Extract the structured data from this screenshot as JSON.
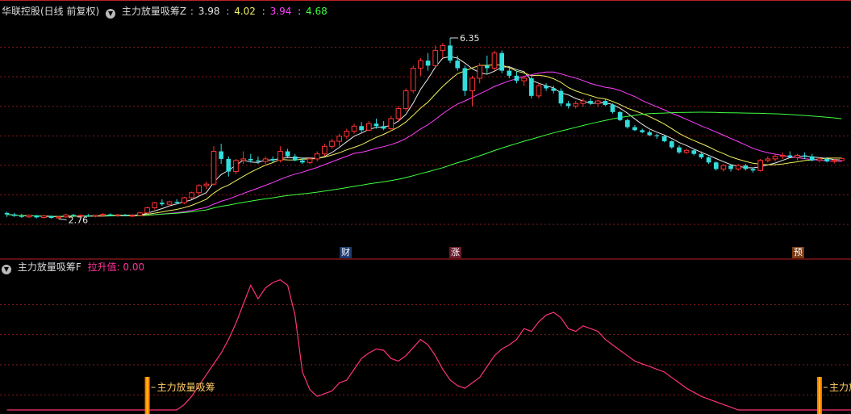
{
  "top_panel": {
    "stock_title": "华联控股(日线 前复权)",
    "indicator_name": "主力放量吸筹Z",
    "value_sep": ":",
    "values": [
      {
        "text": "3.98",
        "color": "#e8e8e8"
      },
      {
        "text": "4.02",
        "color": "#f0f060"
      },
      {
        "text": "3.94",
        "color": "#ff40ff"
      },
      {
        "text": "4.68",
        "color": "#40ff40"
      }
    ],
    "markers": {
      "cai": "财",
      "zhang": "涨",
      "yu": "预"
    }
  },
  "bottom_panel": {
    "indicator_name": "主力放量吸筹F",
    "value_label": "拉升值: 0.00",
    "signal_label": "主力放量吸筹"
  },
  "chart_data": [
    {
      "type": "candlestick",
      "title": "华联控股(日线 前复权)",
      "price_range": [
        2.3,
        6.75
      ],
      "grid": "dotted red horizontal",
      "annotations": [
        {
          "label": "6.35",
          "type": "high",
          "at_index": 60
        },
        {
          "label": "2.76",
          "type": "low",
          "at_index": 7
        }
      ],
      "candles": [
        [
          2.88,
          2.9,
          2.8,
          2.85
        ],
        [
          2.85,
          2.88,
          2.8,
          2.82
        ],
        [
          2.82,
          2.86,
          2.78,
          2.8
        ],
        [
          2.8,
          2.85,
          2.78,
          2.83
        ],
        [
          2.83,
          2.84,
          2.77,
          2.79
        ],
        [
          2.79,
          2.84,
          2.77,
          2.82
        ],
        [
          2.82,
          2.83,
          2.77,
          2.78
        ],
        [
          2.78,
          2.82,
          2.76,
          2.8
        ],
        [
          2.8,
          2.86,
          2.78,
          2.84
        ],
        [
          2.84,
          2.86,
          2.8,
          2.82
        ],
        [
          2.82,
          2.85,
          2.8,
          2.83
        ],
        [
          2.83,
          2.86,
          2.8,
          2.81
        ],
        [
          2.81,
          2.84,
          2.79,
          2.83
        ],
        [
          2.83,
          2.88,
          2.8,
          2.85
        ],
        [
          2.85,
          2.87,
          2.81,
          2.83
        ],
        [
          2.83,
          2.86,
          2.8,
          2.84
        ],
        [
          2.84,
          2.86,
          2.81,
          2.82
        ],
        [
          2.82,
          2.85,
          2.8,
          2.83
        ],
        [
          2.83,
          2.9,
          2.82,
          2.88
        ],
        [
          2.88,
          3.0,
          2.86,
          2.98
        ],
        [
          2.98,
          3.1,
          2.95,
          3.08
        ],
        [
          3.08,
          3.15,
          3.02,
          3.05
        ],
        [
          3.05,
          3.12,
          3.0,
          3.1
        ],
        [
          3.1,
          3.15,
          3.05,
          3.08
        ],
        [
          3.08,
          3.2,
          3.05,
          3.18
        ],
        [
          3.18,
          3.3,
          3.15,
          3.28
        ],
        [
          3.28,
          3.45,
          3.25,
          3.42
        ],
        [
          3.42,
          3.5,
          3.35,
          3.45
        ],
        [
          3.45,
          4.2,
          3.42,
          4.1
        ],
        [
          4.1,
          4.25,
          3.85,
          3.95
        ],
        [
          3.95,
          4.0,
          3.6,
          3.7
        ],
        [
          3.7,
          3.95,
          3.65,
          3.92
        ],
        [
          3.92,
          4.1,
          3.85,
          3.95
        ],
        [
          3.95,
          4.05,
          3.88,
          3.92
        ],
        [
          3.92,
          4.0,
          3.85,
          3.9
        ],
        [
          3.9,
          4.0,
          3.85,
          3.95
        ],
        [
          3.95,
          4.0,
          3.88,
          3.92
        ],
        [
          3.92,
          4.2,
          3.88,
          4.1
        ],
        [
          4.1,
          4.15,
          3.98,
          4.0
        ],
        [
          4.0,
          4.05,
          3.9,
          3.92
        ],
        [
          3.92,
          3.98,
          3.85,
          3.88
        ],
        [
          3.88,
          3.98,
          3.85,
          3.95
        ],
        [
          3.95,
          4.1,
          3.9,
          4.05
        ],
        [
          4.05,
          4.25,
          4.0,
          4.2
        ],
        [
          4.2,
          4.35,
          4.15,
          4.3
        ],
        [
          4.3,
          4.45,
          4.2,
          4.4
        ],
        [
          4.4,
          4.55,
          4.35,
          4.5
        ],
        [
          4.5,
          4.65,
          4.45,
          4.6
        ],
        [
          4.6,
          4.68,
          4.48,
          4.52
        ],
        [
          4.52,
          4.7,
          4.5,
          4.65
        ],
        [
          4.65,
          4.75,
          4.55,
          4.6
        ],
        [
          4.6,
          4.7,
          4.52,
          4.55
        ],
        [
          4.55,
          4.8,
          4.5,
          4.75
        ],
        [
          4.75,
          5.0,
          4.7,
          4.95
        ],
        [
          4.95,
          5.35,
          4.9,
          5.3
        ],
        [
          5.3,
          5.8,
          5.25,
          5.75
        ],
        [
          5.75,
          5.95,
          5.6,
          5.9
        ],
        [
          5.9,
          6.05,
          5.7,
          5.8
        ],
        [
          5.8,
          6.2,
          5.75,
          6.1
        ],
        [
          6.1,
          6.25,
          5.95,
          6.2
        ],
        [
          6.2,
          6.35,
          5.85,
          5.9
        ],
        [
          5.9,
          6.0,
          5.7,
          5.75
        ],
        [
          5.75,
          5.8,
          5.2,
          5.3
        ],
        [
          5.3,
          5.6,
          5.0,
          5.55
        ],
        [
          5.55,
          5.85,
          5.45,
          5.8
        ],
        [
          5.8,
          6.0,
          5.65,
          5.75
        ],
        [
          5.75,
          6.1,
          5.7,
          6.05
        ],
        [
          6.05,
          6.1,
          5.65,
          5.7
        ],
        [
          5.7,
          5.75,
          5.55,
          5.6
        ],
        [
          5.6,
          5.7,
          5.45,
          5.5
        ],
        [
          5.5,
          5.6,
          5.4,
          5.55
        ],
        [
          5.55,
          5.6,
          5.15,
          5.2
        ],
        [
          5.2,
          5.45,
          5.15,
          5.4
        ],
        [
          5.4,
          5.45,
          5.3,
          5.35
        ],
        [
          5.35,
          5.4,
          5.25,
          5.3
        ],
        [
          5.3,
          5.35,
          5.0,
          5.05
        ],
        [
          5.05,
          5.1,
          4.95,
          5.0
        ],
        [
          5.0,
          5.1,
          4.95,
          5.05
        ],
        [
          5.05,
          5.15,
          4.98,
          5.1
        ],
        [
          5.1,
          5.15,
          5.02,
          5.05
        ],
        [
          5.05,
          5.12,
          4.98,
          5.1
        ],
        [
          5.1,
          5.15,
          5.0,
          5.02
        ],
        [
          5.02,
          5.05,
          4.85,
          4.88
        ],
        [
          4.88,
          4.9,
          4.7,
          4.72
        ],
        [
          4.72,
          4.75,
          4.55,
          4.58
        ],
        [
          4.58,
          4.62,
          4.5,
          4.52
        ],
        [
          4.52,
          4.55,
          4.46,
          4.48
        ],
        [
          4.48,
          4.52,
          4.4,
          4.42
        ],
        [
          4.42,
          4.45,
          4.35,
          4.4
        ],
        [
          4.4,
          4.42,
          4.28,
          4.3
        ],
        [
          4.3,
          4.32,
          4.15,
          4.18
        ],
        [
          4.18,
          4.22,
          4.05,
          4.08
        ],
        [
          4.08,
          4.15,
          4.05,
          4.12
        ],
        [
          4.12,
          4.15,
          4.02,
          4.05
        ],
        [
          4.05,
          4.1,
          3.95,
          3.98
        ],
        [
          3.98,
          4.0,
          3.85,
          3.88
        ],
        [
          3.88,
          3.9,
          3.72,
          3.75
        ],
        [
          3.75,
          3.85,
          3.7,
          3.82
        ],
        [
          3.82,
          3.85,
          3.7,
          3.75
        ],
        [
          3.75,
          3.85,
          3.72,
          3.82
        ],
        [
          3.82,
          3.85,
          3.72,
          3.75
        ],
        [
          3.75,
          3.78,
          3.68,
          3.72
        ],
        [
          3.72,
          3.95,
          3.7,
          3.92
        ],
        [
          3.92,
          4.0,
          3.88,
          3.95
        ],
        [
          3.95,
          4.05,
          3.9,
          4.0
        ],
        [
          4.0,
          4.08,
          3.95,
          4.02
        ],
        [
          4.02,
          4.1,
          3.98,
          3.98
        ],
        [
          3.98,
          4.05,
          3.92,
          4.02
        ],
        [
          4.02,
          4.08,
          3.95,
          4.0
        ],
        [
          4.0,
          4.05,
          3.9,
          3.92
        ],
        [
          3.92,
          3.98,
          3.88,
          3.95
        ],
        [
          3.95,
          3.98,
          3.88,
          3.9
        ],
        [
          3.9,
          3.95,
          3.86,
          3.92
        ],
        [
          3.92,
          3.98,
          3.9,
          3.96
        ]
      ]
    },
    {
      "type": "line",
      "title": "主力放量吸筹F",
      "y_range": [
        0,
        100
      ],
      "series": [
        {
          "values": [
            0,
            0,
            0,
            0,
            0,
            0,
            0,
            0,
            0,
            0,
            0,
            0,
            0,
            0,
            0,
            0,
            0,
            0,
            0,
            0,
            0,
            0,
            0,
            0,
            4,
            10,
            18,
            26,
            34,
            42,
            52,
            64,
            78,
            92,
            82,
            90,
            94,
            96,
            92,
            70,
            28,
            15,
            10,
            12,
            14,
            20,
            22,
            30,
            38,
            42,
            45,
            44,
            38,
            36,
            40,
            46,
            52,
            48,
            40,
            30,
            22,
            18,
            16,
            20,
            24,
            32,
            40,
            45,
            48,
            52,
            60,
            58,
            65,
            70,
            72,
            68,
            60,
            58,
            62,
            60,
            58,
            52,
            48,
            44,
            40,
            36,
            34,
            32,
            30,
            28,
            24,
            20,
            16,
            13,
            10,
            8,
            6,
            4,
            2,
            0,
            0,
            0,
            0,
            0,
            0,
            0,
            0,
            0,
            0,
            0,
            0,
            0,
            0,
            0,
            0,
            0
          ]
        }
      ],
      "signals": [
        {
          "label": "主力放量吸筹",
          "at_index": 19
        },
        {
          "label": "主力放量吸筹",
          "at_index": 110
        }
      ]
    }
  ]
}
